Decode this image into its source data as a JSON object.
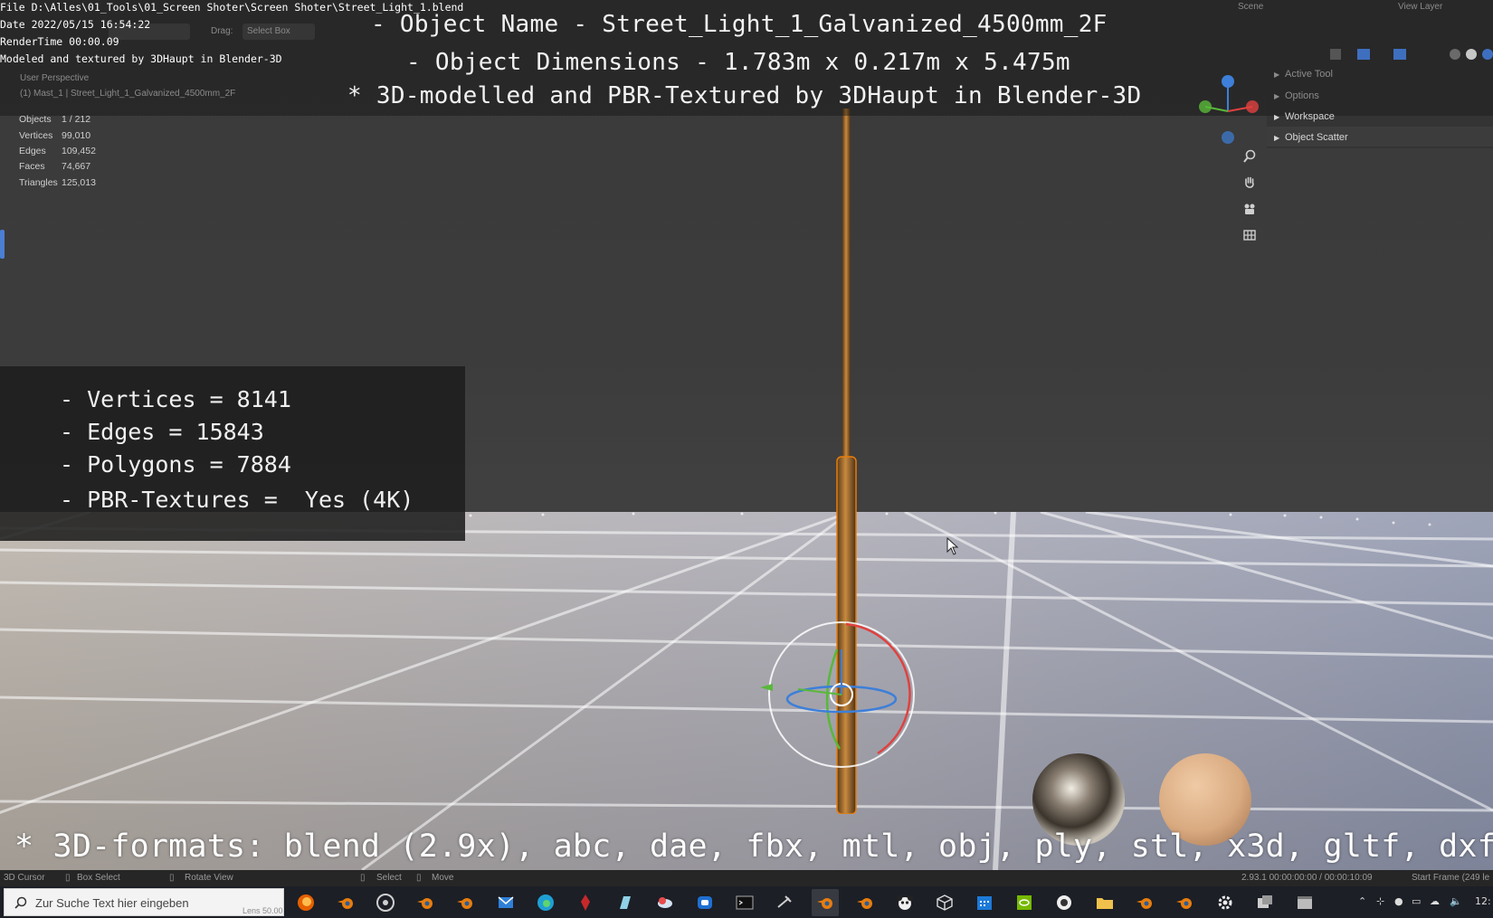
{
  "stamp": {
    "file": "File D:\\Alles\\01_Tools\\01_Screen Shoter\\Screen Shoter\\Street_Light_1.blend",
    "date": "Date 2022/05/15 16:54:22",
    "render_time": "RenderTime 00:00.09",
    "credit": "Modeled and textured by 3DHaupt in Blender-3D"
  },
  "header": {
    "drag_label": "Drag:",
    "drag_value": "Select Box",
    "scene": "Scene",
    "view_layer": "View Layer",
    "view_mode": "User Perspective",
    "active_object": "(1) Mast_1 | Street_Light_1_Galvanized_4500mm_2F"
  },
  "title": {
    "name_line": "- Object Name - Street_Light_1_Galvanized_4500mm_2F",
    "dims_line": "- Object Dimensions -  1.783m x 0.217m x 5.475m",
    "credit_line": "* 3D-modelled and PBR-Textured by 3DHaupt in Blender-3D"
  },
  "stats": [
    {
      "label": "Objects",
      "value": "1 / 212"
    },
    {
      "label": "Vertices",
      "value": "99,010"
    },
    {
      "label": "Edges",
      "value": "109,452"
    },
    {
      "label": "Faces",
      "value": "74,667"
    },
    {
      "label": "Triangles",
      "value": "125,013"
    }
  ],
  "info": [
    "- Vertices = 8141",
    "- Edges = 15843",
    "- Polygons = 7884",
    "- PBR-Textures =  Yes (4K)"
  ],
  "outliner": {
    "items": [
      "Active Tool",
      "Options",
      "Workspace",
      "Object Scatter"
    ]
  },
  "nav_icons": [
    "zoom-icon",
    "hand-pan-icon",
    "camera-icon",
    "grid-view-icon"
  ],
  "formats": "* 3D-formats: blend (2.9x), abc, dae, fbx, mtl, obj, ply, stl, x3d, gltf, dxf",
  "statusbar": {
    "cursor": "3D Cursor",
    "box_select": "Box Select",
    "rotate_view": "Rotate View",
    "select": "Select",
    "move": "Move",
    "version": "2.93.1   00:00:00:00 / 00:00:10:09",
    "start_frame": "Start Frame (249 le",
    "lens": "Lens 50.00"
  },
  "taskbar": {
    "search_placeholder": "Zur Suche Text hier eingeben",
    "clock": "12:"
  },
  "colors": {
    "blender_orange": "#e87d0d",
    "axis_red": "#e0413f",
    "axis_green": "#59b83a",
    "axis_blue": "#3d7fd9"
  }
}
